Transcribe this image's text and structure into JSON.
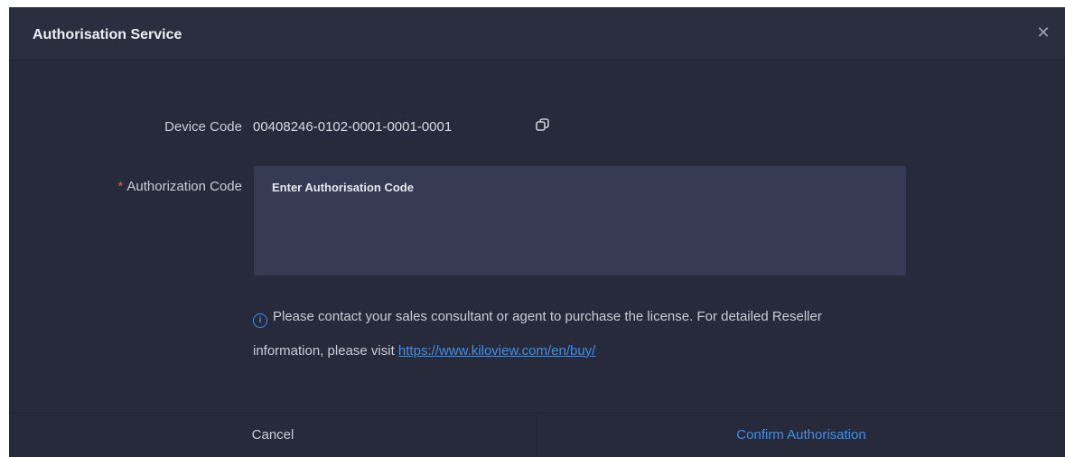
{
  "dialog": {
    "title": "Authorisation Service",
    "close_icon": "close-icon"
  },
  "form": {
    "device_code_label": "Device Code",
    "device_code_value": "00408246-0102-0001-0001-0001",
    "copy_icon": "copy-icon",
    "required_mark": "*",
    "authorization_label": "Authorization Code",
    "authorization_placeholder": "Enter Authorisation Code",
    "authorization_value": ""
  },
  "info": {
    "icon": "info-icon",
    "text": "Please contact your sales consultant or agent to purchase the license. For detailed Reseller information, please visit",
    "link": "https://www.kiloview.com/en/buy/"
  },
  "footer": {
    "cancel_label": "Cancel",
    "confirm_label": "Confirm Authorisation"
  },
  "colors": {
    "background": "#262a3b",
    "accent": "#3d8fe8",
    "required": "#e05a5a"
  }
}
